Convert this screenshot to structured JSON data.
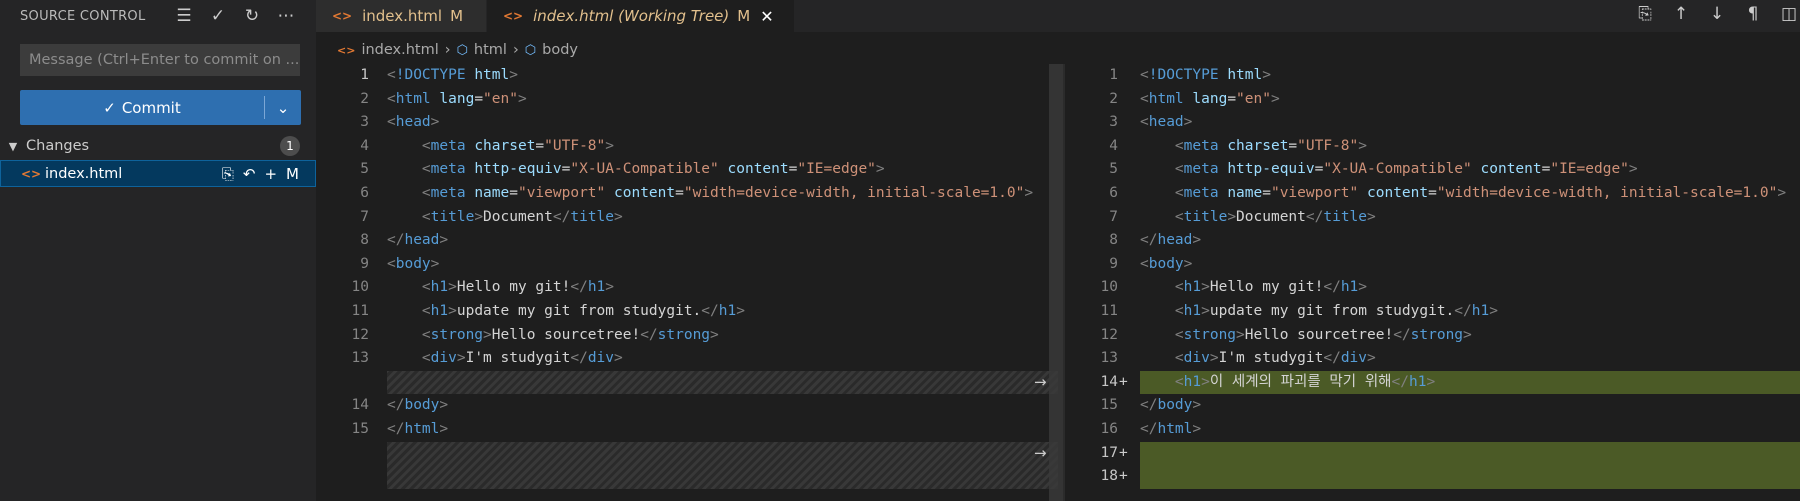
{
  "sidebar": {
    "title": "SOURCE CONTROL",
    "actions": [
      "list-icon",
      "check-icon",
      "refresh-icon",
      "more-icon"
    ],
    "message_placeholder": "Message (Ctrl+Enter to commit on ...",
    "commit_label": "Commit",
    "changes_label": "Changes",
    "changes_count": "1",
    "file": {
      "name": "index.html",
      "status": "M"
    }
  },
  "tabs": [
    {
      "label": "index.html",
      "status": "M"
    },
    {
      "label": "index.html (Working Tree)",
      "status": "M"
    }
  ],
  "breadcrumb": [
    "index.html",
    "html",
    "body"
  ],
  "colors": {
    "accent": "#2e6fb0",
    "added": "#4b5a26",
    "modified": "#e2c08d"
  },
  "left_lines": [
    {
      "n": "1",
      "text": "<!DOCTYPE html>"
    },
    {
      "n": "2",
      "text": "<html lang=\"en\">"
    },
    {
      "n": "3",
      "text": "<head>"
    },
    {
      "n": "4",
      "text": "    <meta charset=\"UTF-8\">"
    },
    {
      "n": "5",
      "text": "    <meta http-equiv=\"X-UA-Compatible\" content=\"IE=edge\">"
    },
    {
      "n": "6",
      "text": "    <meta name=\"viewport\" content=\"width=device-width, initial-scale=1.0\">"
    },
    {
      "n": "7",
      "text": "    <title>Document</title>"
    },
    {
      "n": "8",
      "text": "</head>"
    },
    {
      "n": "9",
      "text": "<body>"
    },
    {
      "n": "10",
      "text": "    <h1>Hello my git!</h1>"
    },
    {
      "n": "11",
      "text": "    <h1>update my git from studygit.</h1>"
    },
    {
      "n": "12",
      "text": "    <strong>Hello sourcetree!</strong>"
    },
    {
      "n": "13",
      "text": "    <div>I'm studygit</div>"
    },
    {
      "n": "14",
      "text": "</body>"
    },
    {
      "n": "15",
      "text": "</html>"
    }
  ],
  "right_lines": [
    {
      "n": "1",
      "text": "<!DOCTYPE html>"
    },
    {
      "n": "2",
      "text": "<html lang=\"en\">"
    },
    {
      "n": "3",
      "text": "<head>"
    },
    {
      "n": "4",
      "text": "    <meta charset=\"UTF-8\">"
    },
    {
      "n": "5",
      "text": "    <meta http-equiv=\"X-UA-Compatible\" content=\"IE=edge\">"
    },
    {
      "n": "6",
      "text": "    <meta name=\"viewport\" content=\"width=device-width, initial-scale=1.0\">"
    },
    {
      "n": "7",
      "text": "    <title>Document</title>"
    },
    {
      "n": "8",
      "text": "</head>"
    },
    {
      "n": "9",
      "text": "<body>"
    },
    {
      "n": "10",
      "text": "    <h1>Hello my git!</h1>"
    },
    {
      "n": "11",
      "text": "    <h1>update my git from studygit.</h1>"
    },
    {
      "n": "12",
      "text": "    <strong>Hello sourcetree!</strong>"
    },
    {
      "n": "13",
      "text": "    <div>I'm studygit</div>"
    },
    {
      "n": "14",
      "text": "    <h1>이 세계의 파괴를 막기 위해</h1>",
      "added": true
    },
    {
      "n": "15",
      "text": "</body>"
    },
    {
      "n": "16",
      "text": "</html>"
    },
    {
      "n": "17",
      "text": "",
      "added": true
    },
    {
      "n": "18",
      "text": "",
      "added": true
    }
  ]
}
